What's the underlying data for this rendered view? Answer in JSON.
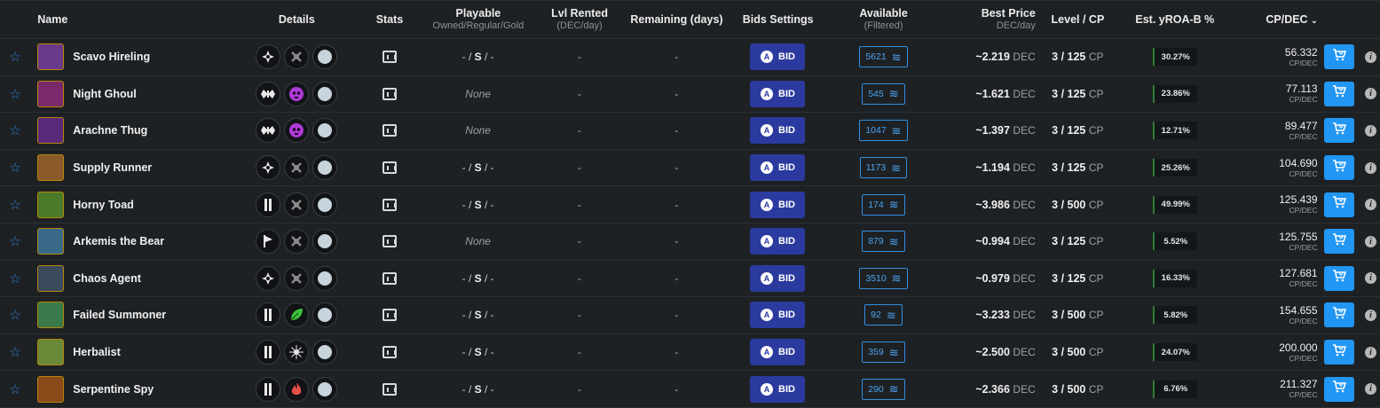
{
  "header": {
    "name": "Name",
    "details": "Details",
    "stats": "Stats",
    "playable": "Playable",
    "playable_sub": "Owned/Regular/Gold",
    "lvl_rented": "Lvl Rented",
    "lvl_rented_sub": "(DEC/day)",
    "remaining": "Remaining (days)",
    "bids_settings": "Bids Settings",
    "available": "Available",
    "available_sub": "(Filtered)",
    "best_price": "Best Price",
    "best_price_sub": "DEC/day",
    "level_cp": "Level / CP",
    "est_roa": "Est. yROA-B %",
    "cp_dec": "CP/DEC",
    "sort_icon": "⌄"
  },
  "labels": {
    "bid": "BID",
    "dec": "DEC",
    "cp": "CP",
    "cp_dec_unit": "CP/DEC",
    "dash": "-",
    "info": "i"
  },
  "rows": [
    {
      "name": "Scavo Hireling",
      "d1": "sneak",
      "d2": "none",
      "playable_type": "osg",
      "playable": "- / S / -",
      "lvl": "-",
      "rem": "-",
      "available": "5621",
      "price": "~2.219",
      "level": "3 / 125",
      "roa": "30.27%",
      "cpdec": "56.332",
      "color": "#6a3a8a"
    },
    {
      "name": "Night Ghoul",
      "d1": "wing",
      "d2": "death",
      "playable_type": "none",
      "playable": "None",
      "lvl": "-",
      "rem": "-",
      "available": "545",
      "price": "~1.621",
      "level": "3 / 125",
      "roa": "23.86%",
      "cpdec": "77.113",
      "color": "#7a2a6a"
    },
    {
      "name": "Arachne Thug",
      "d1": "wing",
      "d2": "death",
      "playable_type": "none",
      "playable": "None",
      "lvl": "-",
      "rem": "-",
      "available": "1047",
      "price": "~1.397",
      "level": "3 / 125",
      "roa": "12.71%",
      "cpdec": "89.477",
      "color": "#5a2a7a"
    },
    {
      "name": "Supply Runner",
      "d1": "sneak",
      "d2": "none",
      "playable_type": "osg",
      "playable": "- / S / -",
      "lvl": "-",
      "rem": "-",
      "available": "1173",
      "price": "~1.194",
      "level": "3 / 125",
      "roa": "25.26%",
      "cpdec": "104.690",
      "color": "#8a5a2a"
    },
    {
      "name": "Horny Toad",
      "d1": "pillar",
      "d2": "none",
      "playable_type": "osg",
      "playable": "- / S / -",
      "lvl": "-",
      "rem": "-",
      "available": "174",
      "price": "~3.986",
      "level": "3 / 500",
      "roa": "49.99%",
      "cpdec": "125.439",
      "color": "#4a7a2a"
    },
    {
      "name": "Arkemis the Bear",
      "d1": "flag",
      "d2": "none",
      "playable_type": "none",
      "playable": "None",
      "lvl": "-",
      "rem": "-",
      "available": "879",
      "price": "~0.994",
      "level": "3 / 125",
      "roa": "5.52%",
      "cpdec": "125.755",
      "color": "#3a6a8a"
    },
    {
      "name": "Chaos Agent",
      "d1": "sneak",
      "d2": "none",
      "playable_type": "osg",
      "playable": "- / S / -",
      "lvl": "-",
      "rem": "-",
      "available": "3510",
      "price": "~0.979",
      "level": "3 / 125",
      "roa": "16.33%",
      "cpdec": "127.681",
      "color": "#3a4a5a"
    },
    {
      "name": "Failed Summoner",
      "d1": "pillar",
      "d2": "earth",
      "playable_type": "osg",
      "playable": "- / S / -",
      "lvl": "-",
      "rem": "-",
      "available": "92",
      "price": "~3.233",
      "level": "3 / 500",
      "roa": "5.82%",
      "cpdec": "154.655",
      "color": "#3a7a4a"
    },
    {
      "name": "Herbalist",
      "d1": "pillar",
      "d2": "life",
      "playable_type": "osg",
      "playable": "- / S / -",
      "lvl": "-",
      "rem": "-",
      "available": "359",
      "price": "~2.500",
      "level": "3 / 500",
      "roa": "24.07%",
      "cpdec": "200.000",
      "color": "#6a8a3a"
    },
    {
      "name": "Serpentine Spy",
      "d1": "pillar",
      "d2": "fire",
      "playable_type": "osg",
      "playable": "- / S / -",
      "lvl": "-",
      "rem": "-",
      "available": "290",
      "price": "~2.366",
      "level": "3 / 500",
      "roa": "6.76%",
      "cpdec": "211.327",
      "color": "#8a4a1a"
    }
  ]
}
